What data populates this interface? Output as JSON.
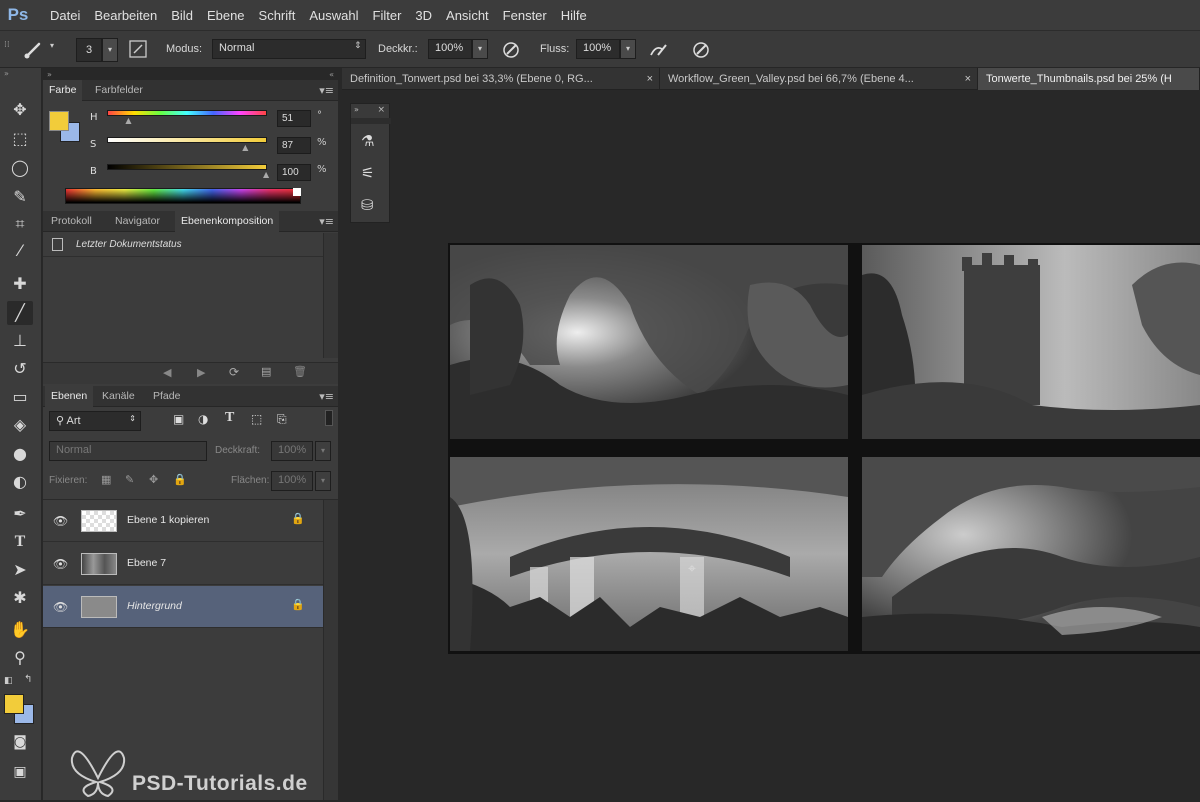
{
  "app": {
    "logo": "Ps"
  },
  "menu": [
    "Datei",
    "Bearbeiten",
    "Bild",
    "Ebene",
    "Schrift",
    "Auswahl",
    "Filter",
    "3D",
    "Ansicht",
    "Fenster",
    "Hilfe"
  ],
  "options": {
    "brush_size": "3",
    "mode_label": "Modus:",
    "mode_value": "Normal",
    "opacity_label": "Deckkr.:",
    "opacity_value": "100%",
    "flow_label": "Fluss:",
    "flow_value": "100%"
  },
  "tabs": [
    {
      "label": "Definition_Tonwert.psd bei 33,3% (Ebene 0, RG...",
      "close": "×"
    },
    {
      "label": "Workflow_Green_Valley.psd bei 66,7% (Ebene 4...",
      "close": "×"
    },
    {
      "label": "Tonwerte_Thumbnails.psd bei 25% (H",
      "close": ""
    }
  ],
  "color_panel": {
    "tabs": [
      "Farbe",
      "Farbfelder"
    ],
    "h_label": "H",
    "h_value": "51",
    "h_unit": "°",
    "s_label": "S",
    "s_value": "87",
    "s_unit": "%",
    "b_label": "B",
    "b_value": "100",
    "b_unit": "%",
    "h_level": 0.14,
    "s_level": 0.87,
    "b_level": 1.0,
    "foreground": "#f2cc3a",
    "background": "#9bb8e8"
  },
  "history_panel": {
    "tabs": [
      "Protokoll",
      "Navigator",
      "Ebenenkomposition"
    ],
    "item": "Letzter Dokumentstatus"
  },
  "layers_panel": {
    "tabs": [
      "Ebenen",
      "Kanäle",
      "Pfade"
    ],
    "filter": "Art",
    "blend_mode": "Normal",
    "opacity_label": "Deckkraft:",
    "opacity_value": "100%",
    "lock_label": "Fixieren:",
    "fill_label": "Flächen:",
    "fill_value": "100%",
    "layers": [
      {
        "name": "Ebene 1 kopieren",
        "selected": false
      },
      {
        "name": "Ebene 7",
        "selected": false
      },
      {
        "name": "Hintergrund",
        "selected": true
      }
    ]
  },
  "watermark": "PSD-Tutorials.de"
}
